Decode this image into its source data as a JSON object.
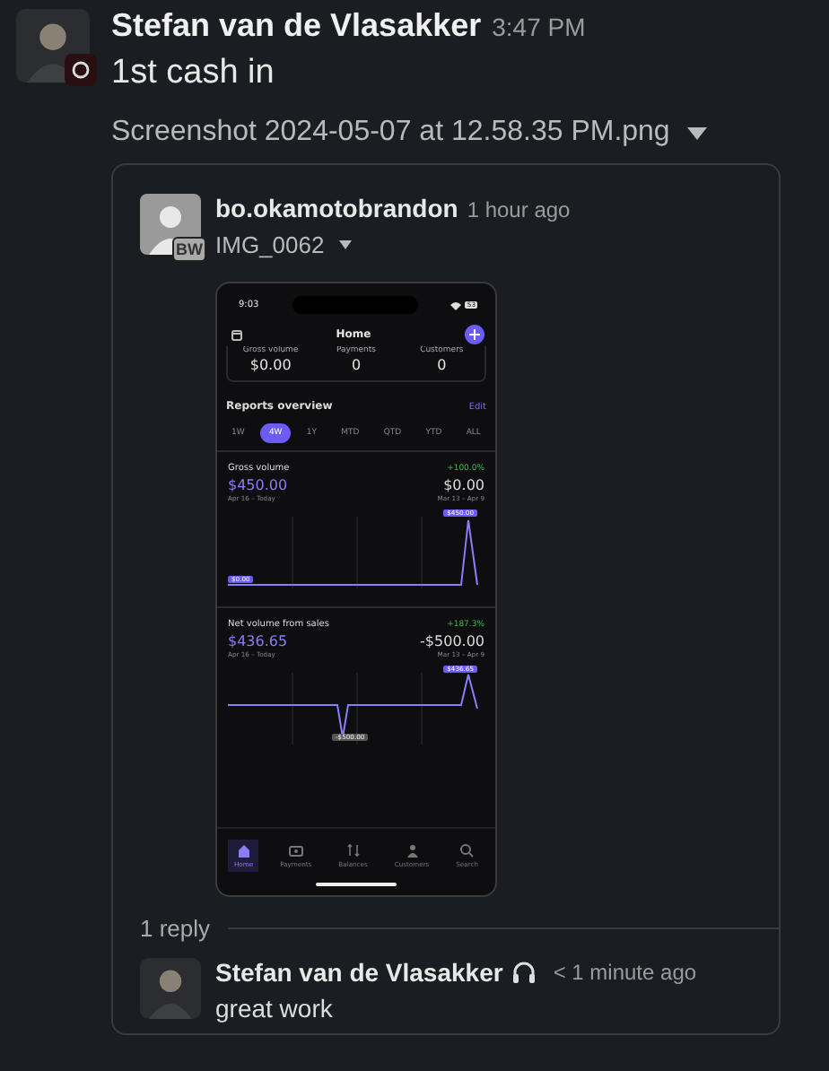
{
  "message": {
    "author": "Stefan van de Vlasakker",
    "time": "3:47 PM",
    "text": "1st cash in",
    "file": "Screenshot 2024-05-07 at 12.58.35 PM.png"
  },
  "shared": {
    "author": "bo.okamotobrandon",
    "avatar_badge": "BW",
    "time": "1 hour ago",
    "file": "IMG_0062",
    "phone": {
      "clock": "9:03",
      "battery": "53",
      "title": "Home",
      "summary": [
        {
          "label": "Gross volume",
          "value": "$0.00"
        },
        {
          "label": "Payments",
          "value": "0"
        },
        {
          "label": "Customers",
          "value": "0"
        }
      ],
      "section": "Reports overview",
      "edit": "Edit",
      "ranges": [
        {
          "label": "1W",
          "selected": false
        },
        {
          "label": "4W",
          "selected": true
        },
        {
          "label": "1Y",
          "selected": false
        },
        {
          "label": "MTD",
          "selected": false
        },
        {
          "label": "QTD",
          "selected": false
        },
        {
          "label": "YTD",
          "selected": false
        },
        {
          "label": "ALL",
          "selected": false
        }
      ],
      "cards": [
        {
          "title": "Gross volume",
          "change": "+100.0%",
          "current": "$450.00",
          "previous": "$0.00",
          "current_period": "Apr 16 – Today",
          "previous_period": "Mar 13 – Apr 9",
          "high_tag": "$450.00",
          "low_tag": "$0.00"
        },
        {
          "title": "Net volume from sales",
          "change": "+187.3%",
          "current": "$436.65",
          "previous": "-$500.00",
          "current_period": "Apr 16 – Today",
          "previous_period": "Mar 13 – Apr 9",
          "high_tag": "$436.65",
          "low_tag": "-$500.00"
        }
      ],
      "nav": [
        {
          "label": "Home",
          "selected": true
        },
        {
          "label": "Payments",
          "selected": false
        },
        {
          "label": "Balances",
          "selected": false
        },
        {
          "label": "Customers",
          "selected": false
        },
        {
          "label": "Search",
          "selected": false
        }
      ]
    }
  },
  "thread": {
    "replies_label": "1 reply",
    "replies": [
      {
        "author": "Stefan van de Vlasakker",
        "time": "< 1 minute ago",
        "text": "great work"
      }
    ]
  }
}
